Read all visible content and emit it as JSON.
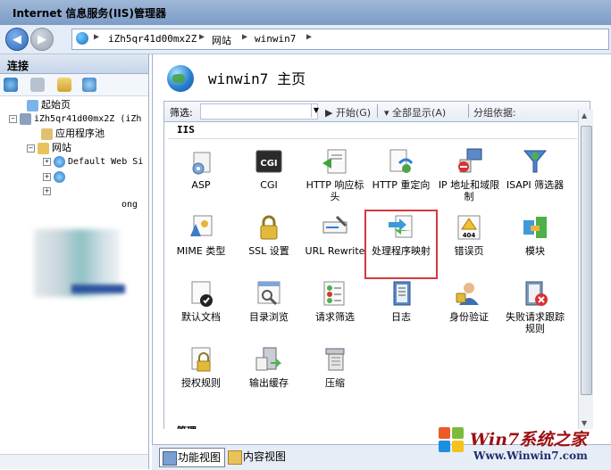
{
  "window": {
    "title": "Internet 信息服务(IIS)管理器"
  },
  "address": {
    "crumbs": [
      "iZh5qr41d00mx2Z",
      "网站",
      "winwin7"
    ]
  },
  "left_panel": {
    "header": "连接",
    "tree": [
      {
        "label": "起始页"
      },
      {
        "label": "iZh5qr41d00mx2Z (iZh"
      },
      {
        "label": "应用程序池"
      },
      {
        "label": "网站"
      },
      {
        "label": "Default Web Si"
      },
      {
        "label": "ong"
      }
    ]
  },
  "main": {
    "page_title": "winwin7 主页",
    "filter": {
      "label": "筛选:",
      "start": "开始(G)",
      "show_all": "全部显示(A)",
      "group_by": "分组依据:"
    },
    "section": "IIS",
    "section2": "管理",
    "tiles": [
      {
        "label": "ASP"
      },
      {
        "label": "CGI"
      },
      {
        "label": "HTTP 响应标头"
      },
      {
        "label": "HTTP 重定向"
      },
      {
        "label": "IP 地址和域限制"
      },
      {
        "label": "ISAPI 筛选器"
      },
      {
        "label": "MIME 类型"
      },
      {
        "label": "SSL 设置"
      },
      {
        "label": "URL Rewrite"
      },
      {
        "label": "处理程序映射"
      },
      {
        "label": "错误页"
      },
      {
        "label": "模块"
      },
      {
        "label": "默认文档"
      },
      {
        "label": "目录浏览"
      },
      {
        "label": "请求筛选"
      },
      {
        "label": "日志"
      },
      {
        "label": "身份验证"
      },
      {
        "label": "失败请求跟踪规则"
      },
      {
        "label": "授权规则"
      },
      {
        "label": "输出缓存"
      },
      {
        "label": "压缩"
      }
    ]
  },
  "bottom": {
    "features_view": "功能视图",
    "content_view": "内容视图"
  },
  "watermark": {
    "brand": "Win7系统之家",
    "url": "Www.Winwin7.com"
  },
  "colors": {
    "selection": "#d6393c",
    "header": "#c6d5ea",
    "brand": "#9b0f12"
  }
}
